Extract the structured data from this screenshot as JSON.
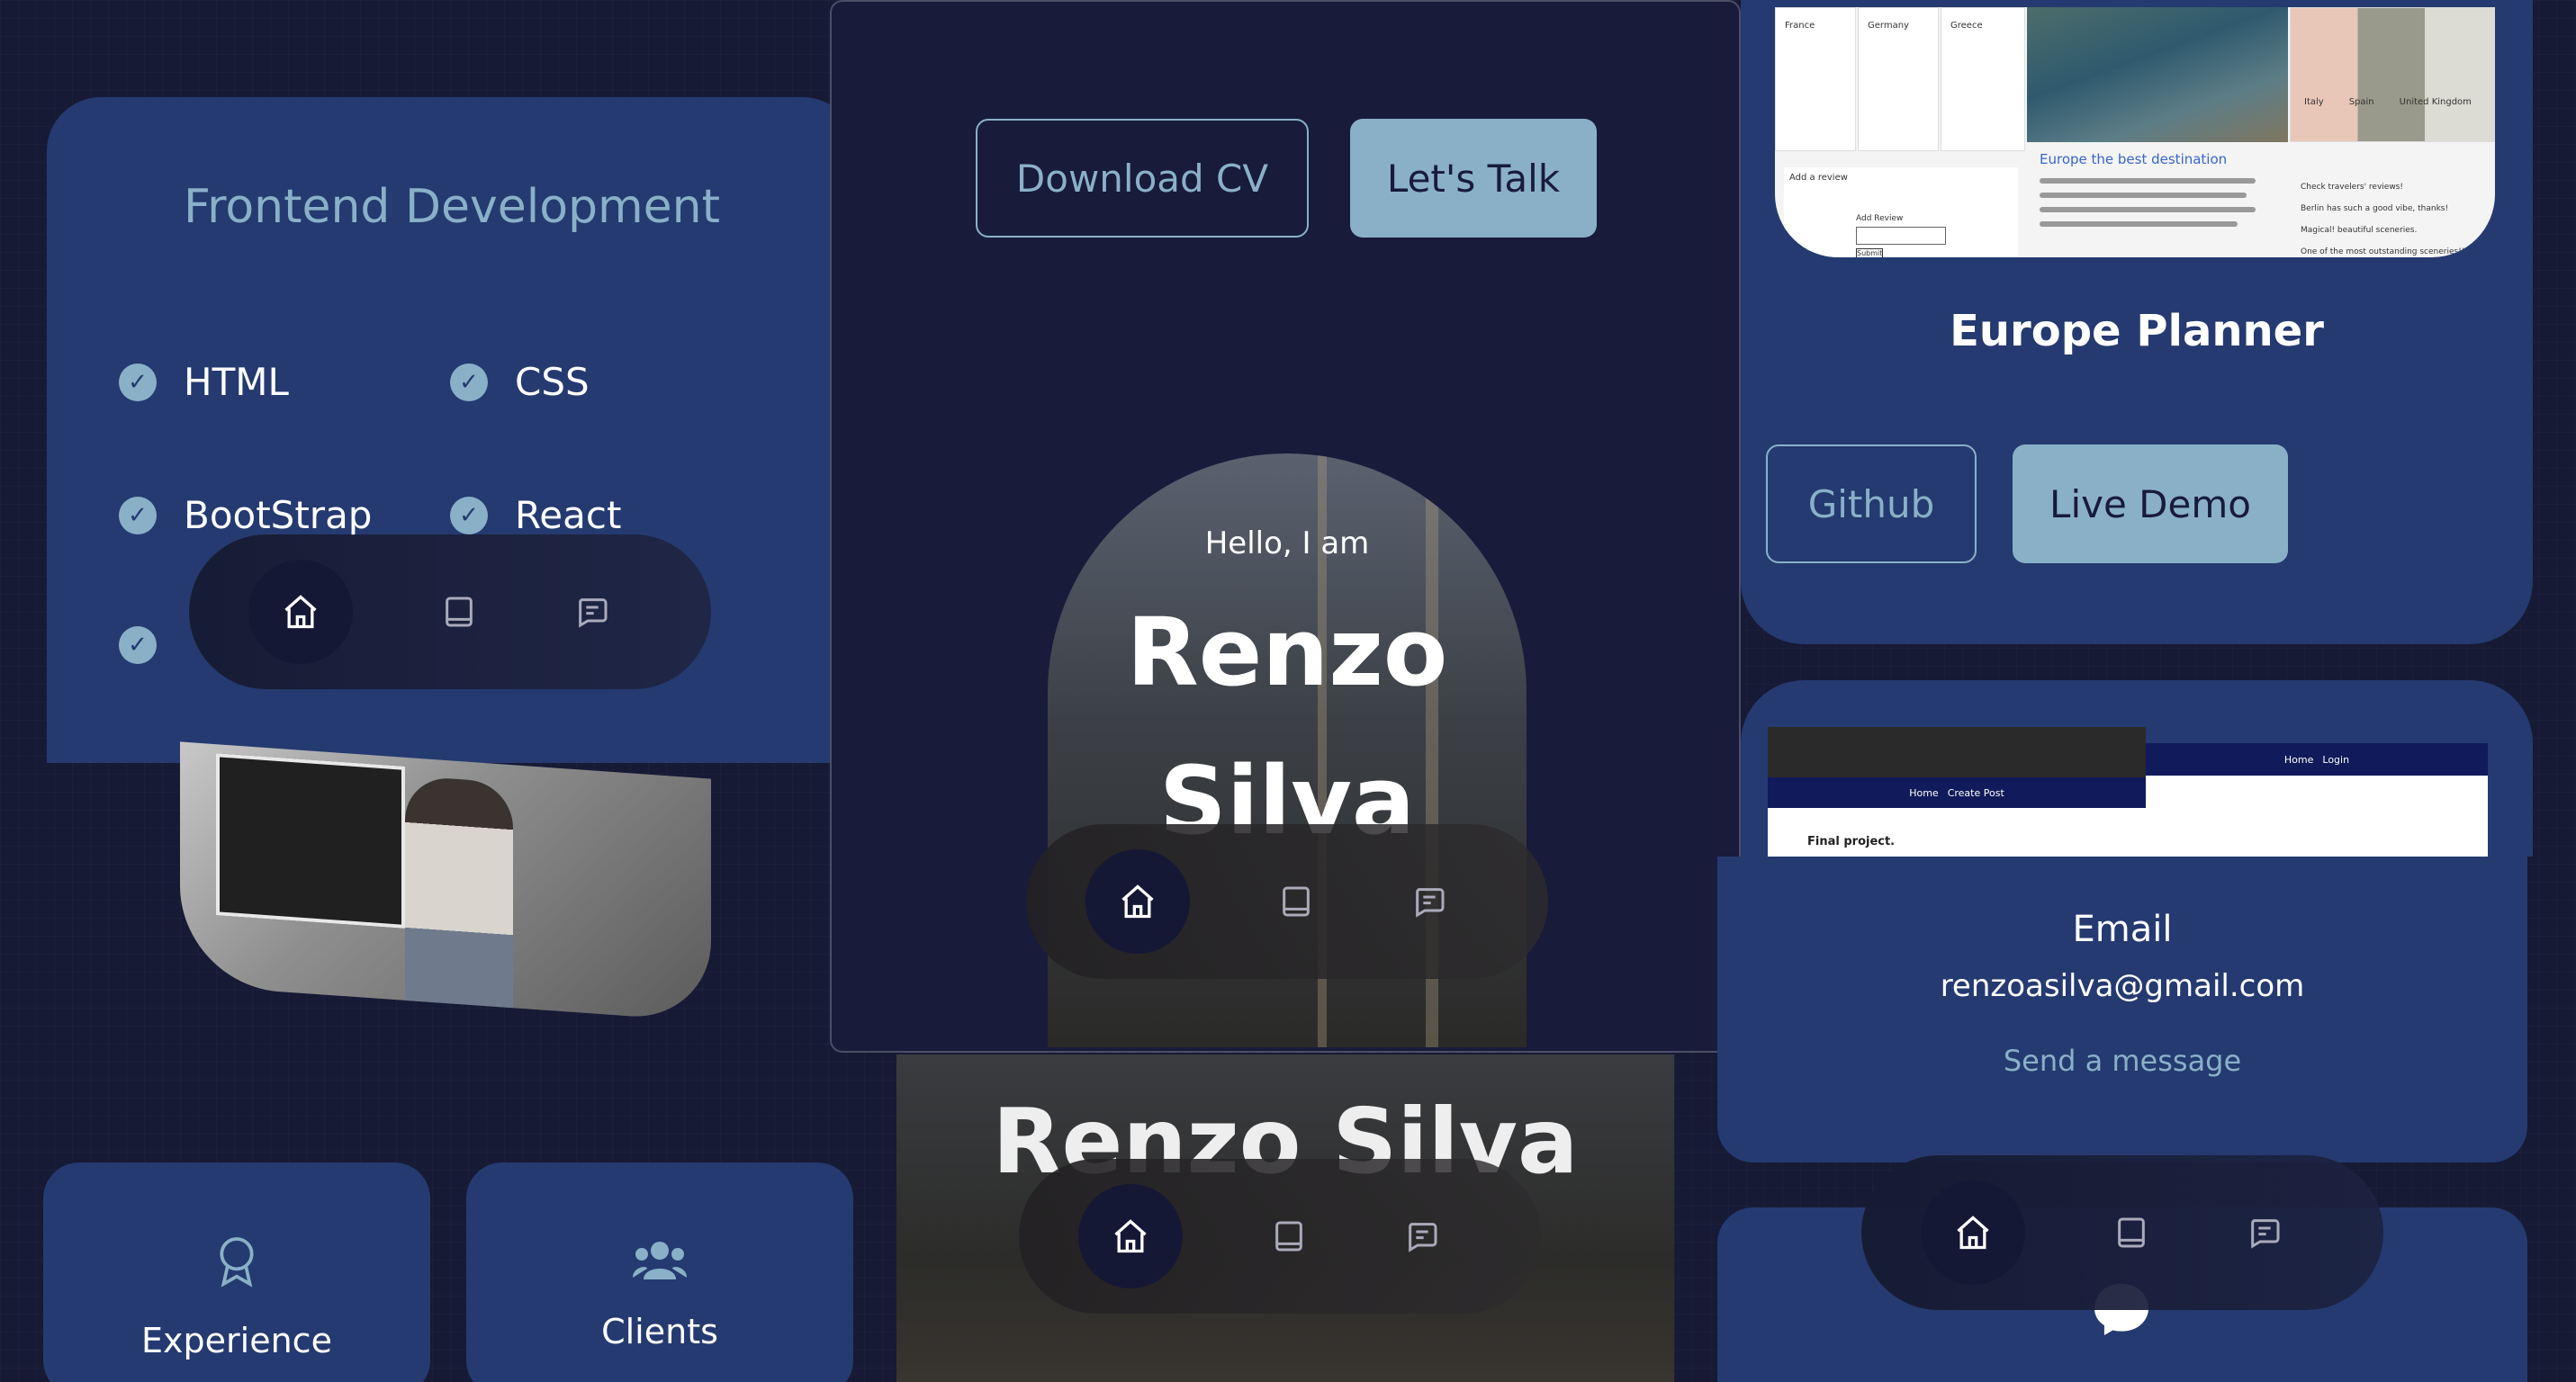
{
  "skills": {
    "title": "Frontend Development",
    "items": [
      "HTML",
      "CSS",
      "BootStrap",
      "React"
    ]
  },
  "about_cards": [
    {
      "label": "Experience",
      "icon": "award-icon"
    },
    {
      "label": "Clients",
      "icon": "users-icon"
    }
  ],
  "hero": {
    "download_label": "Download CV",
    "talk_label": "Let's Talk",
    "greeting": "Hello, I am",
    "first_name": "Renzo",
    "last_name": "Silva",
    "full_name": "Renzo Silva"
  },
  "nav": {
    "icons": [
      "home-icon",
      "book-icon",
      "message-icon"
    ]
  },
  "project": {
    "title": "Europe Planner",
    "github_label": "Github",
    "demo_label": "Live Demo",
    "screenshot": {
      "countries": [
        "France",
        "Germany",
        "Greece",
        "Italy",
        "Spain",
        "United Kingdom"
      ],
      "heading": "Europe the best destination",
      "add_review": "Add a review",
      "review_label": "Add Review",
      "submit": "Submit",
      "reviews_title": "Check travelers' reviews!",
      "reviews": [
        "Berlin has such a good vibe, thanks!",
        "Magical! beautiful sceneries.",
        "One of the most outstanding sceneries!!!"
      ]
    }
  },
  "blog_shot": {
    "nav_left": [
      "Home",
      "Create Post"
    ],
    "nav_right": [
      "Home",
      "Login"
    ],
    "post_title": "Final project."
  },
  "contact": {
    "label": "Email",
    "email": "renzoasilva@gmail.com",
    "cta": "Send a message"
  },
  "colors": {
    "background": "#161a35",
    "card": "#253a70",
    "accent": "#8ab0c8",
    "window": "#181b3a"
  }
}
